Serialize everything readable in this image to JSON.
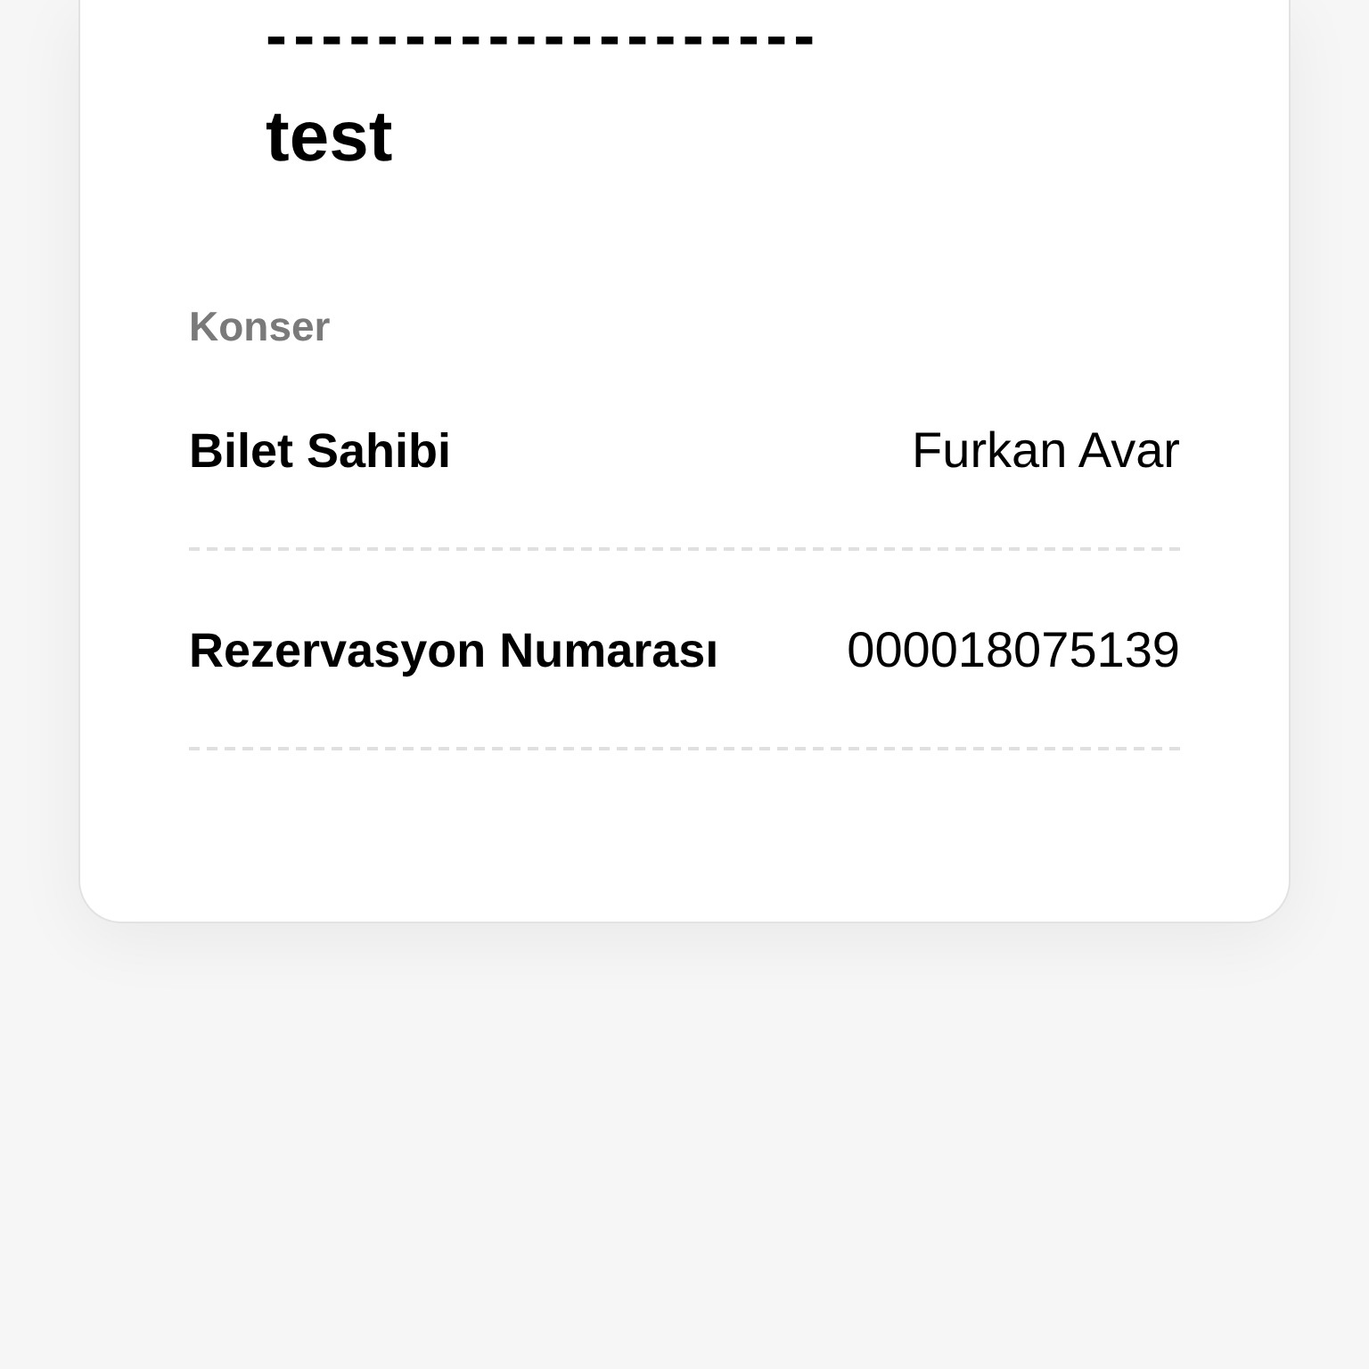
{
  "ticket": {
    "separator": "--------------------",
    "title": "test",
    "category": "Konser",
    "fields": [
      {
        "label": "Bilet Sahibi",
        "value": "Furkan Avar"
      },
      {
        "label": "Rezervasyon Numarası",
        "value": "000018075139"
      }
    ]
  }
}
